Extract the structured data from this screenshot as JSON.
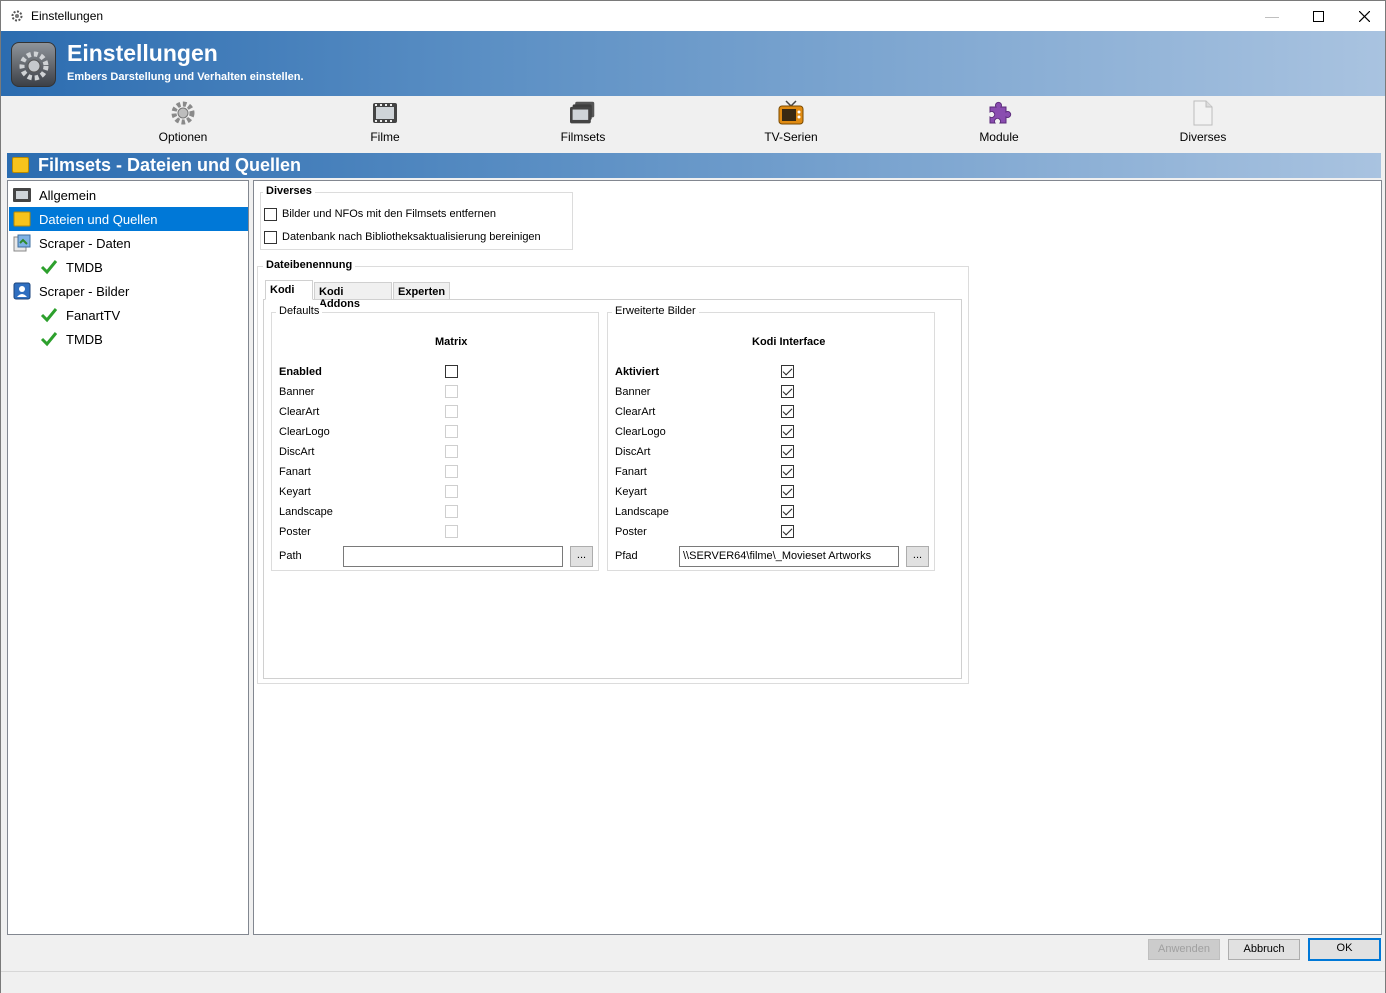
{
  "window": {
    "title": "Einstellungen"
  },
  "header": {
    "title": "Einstellungen",
    "subtitle": "Embers Darstellung und Verhalten einstellen."
  },
  "toolbar": {
    "items": [
      {
        "label": "Optionen",
        "icon": "gear-icon"
      },
      {
        "label": "Filme",
        "icon": "film-icon"
      },
      {
        "label": "Filmsets",
        "icon": "filmset-icon"
      },
      {
        "label": "TV-Serien",
        "icon": "tv-icon"
      },
      {
        "label": "Module",
        "icon": "puzzle-icon"
      },
      {
        "label": "Diverses",
        "icon": "document-icon"
      }
    ]
  },
  "section": {
    "title": "Filmsets - Dateien und Quellen"
  },
  "tree": {
    "items": [
      {
        "label": "Allgemein",
        "icon": "film-icon"
      },
      {
        "label": "Dateien und Quellen",
        "icon": "folder-icon",
        "selected": true
      },
      {
        "label": "Scraper - Daten",
        "icon": "scraper-data-icon"
      },
      {
        "label": "TMDB",
        "icon": "checkmark-icon"
      },
      {
        "label": "Scraper - Bilder",
        "icon": "scraper-image-icon"
      },
      {
        "label": "FanartTV",
        "icon": "checkmark-icon"
      },
      {
        "label": "TMDB",
        "icon": "checkmark-icon"
      }
    ]
  },
  "diverses": {
    "legend": "Diverses",
    "options": [
      {
        "label": "Bilder und NFOs mit den Filmsets entfernen",
        "checked": false
      },
      {
        "label": "Datenbank nach Bibliotheksaktualisierung bereinigen",
        "checked": false
      }
    ]
  },
  "dateibenennung": {
    "legend": "Dateibenennung",
    "tabs": [
      "Kodi",
      "Kodi Addons",
      "Experten"
    ],
    "defaults": {
      "legend": "Defaults",
      "column_header": "Matrix",
      "rows": [
        "Enabled",
        "Banner",
        "ClearArt",
        "ClearLogo",
        "DiscArt",
        "Fanart",
        "Keyart",
        "Landscape",
        "Poster"
      ],
      "path_label": "Path",
      "path_value": "",
      "browse_label": "..."
    },
    "erweiterte": {
      "legend": "Erweiterte Bilder",
      "column_header": "Kodi Interface",
      "rows": [
        "Aktiviert",
        "Banner",
        "ClearArt",
        "ClearLogo",
        "DiscArt",
        "Fanart",
        "Keyart",
        "Landscape",
        "Poster"
      ],
      "path_label": "Pfad",
      "path_value": "\\\\SERVER64\\filme\\_Movieset Artworks",
      "browse_label": "..."
    }
  },
  "footer": {
    "apply": "Anwenden",
    "cancel": "Abbruch",
    "ok": "OK"
  }
}
